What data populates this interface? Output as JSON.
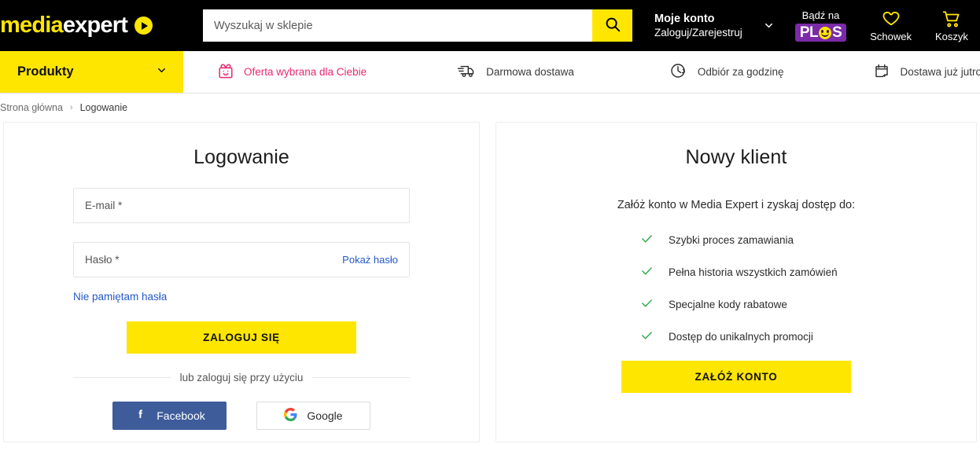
{
  "header": {
    "logo": {
      "part1": "media",
      "part2": "expert",
      "icon": "play-circle-icon"
    },
    "search": {
      "placeholder": "Wyszukaj w sklepie",
      "value": "",
      "button_icon": "search-icon"
    },
    "account": {
      "title": "Moje konto",
      "subtitle": "Zaloguj/Zarejestruj",
      "chevron": "chevron-down-icon"
    },
    "plus": {
      "label": "Bądź na",
      "badge_left": "PL",
      "badge_right": "S",
      "badge_smiley": "smiley-icon"
    },
    "wishlist": {
      "label": "Schowek",
      "icon": "heart-icon"
    },
    "cart": {
      "label": "Koszyk",
      "icon": "cart-icon"
    }
  },
  "nav": {
    "products_label": "Produkty",
    "products_chevron": "chevron-down-icon",
    "items": [
      {
        "label": "Oferta wybrana dla Ciebie",
        "icon": "gift-icon"
      },
      {
        "label": "Darmowa dostawa",
        "icon": "truck-icon"
      },
      {
        "label": "Odbiór za godzinę",
        "icon": "clock-icon"
      },
      {
        "label": "Dostawa już jutro",
        "icon": "calendar-icon"
      }
    ]
  },
  "breadcrumb": {
    "home": "Strona główna",
    "separator": "›",
    "current": "Logowanie"
  },
  "login": {
    "title": "Logowanie",
    "email": {
      "label": "E-mail *",
      "value": ""
    },
    "password": {
      "label": "Hasło *",
      "value": "",
      "show_label": "Pokaż hasło"
    },
    "forgot_label": "Nie pamiętam hasła",
    "submit_label": "ZALOGUJ SIĘ",
    "divider_label": "lub zaloguj się przy użyciu",
    "facebook_label": "Facebook",
    "google_label": "Google"
  },
  "register": {
    "title": "Nowy klient",
    "subtitle": "Załóż konto w Media Expert i zyskaj dostęp do:",
    "benefits": [
      "Szybki proces zamawiania",
      "Pełna historia wszystkich zamówień",
      "Specjalne kody rabatowe",
      "Dostęp do unikalnych promocji"
    ],
    "submit_label": "ZAŁÓŻ KONTO"
  },
  "colors": {
    "brand_yellow": "#FFE600",
    "header_black": "#000000",
    "link_blue": "#2558C7",
    "promo_pink": "#E8286E",
    "check_green": "#2FA84F",
    "plus_purple": "#7B2AA8",
    "facebook_blue": "#3E5C9A"
  }
}
